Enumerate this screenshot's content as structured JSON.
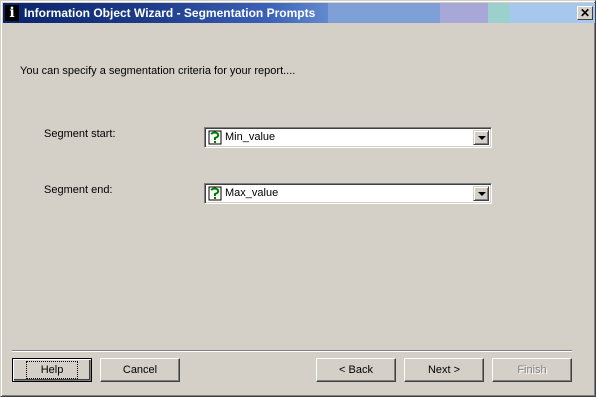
{
  "window": {
    "title": "Information Object Wizard - Segmentation Prompts",
    "close_glyph": "✕"
  },
  "main": {
    "description": "You can specify a segmentation criteria for your report....",
    "segment_start": {
      "label": "Segment start:",
      "value": "Min_value",
      "icon": "parameter-icon"
    },
    "segment_end": {
      "label": "Segment end:",
      "value": "Max_value",
      "icon": "parameter-icon"
    }
  },
  "buttons": {
    "help": "Help",
    "cancel": "Cancel",
    "back": "< Back",
    "next": "Next >",
    "finish": "Finish"
  }
}
